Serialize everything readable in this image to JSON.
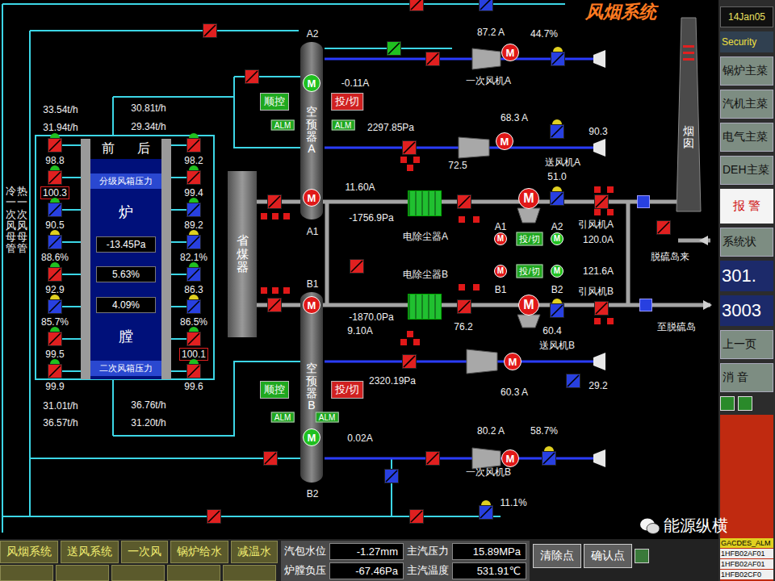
{
  "title": "风烟系统",
  "mains": [
    "冷一次风母管",
    "热一次风母管"
  ],
  "furnace": {
    "front": "前",
    "back": "后",
    "upper_box": "分级风箱压力",
    "lower_box": "二次风箱压力",
    "top_char": "炉",
    "bottom_char": "膛",
    "pressure": "-13.45Pa",
    "readings": [
      "5.63%",
      "4.09%"
    ]
  },
  "furnace_dampers": {
    "left": [
      {
        "value": "98.8",
        "boxed": false,
        "color": "#e02020",
        "hat": "#20c020"
      },
      {
        "value": "100.3",
        "boxed": true,
        "color": "#e02020",
        "hat": "#20c020"
      },
      {
        "value": "90.5",
        "boxed": false,
        "color": "#2840e0",
        "hat": "#20c020"
      },
      {
        "value": "88.6%",
        "boxed": false,
        "color": "#2840e0",
        "hat": "#e0d020"
      },
      {
        "value": "92.9",
        "boxed": false,
        "color": "#e02020",
        "hat": "#20c020"
      },
      {
        "value": "85.7%",
        "boxed": false,
        "color": "#2840e0",
        "hat": "#e0d020"
      },
      {
        "value": "99.5",
        "boxed": false,
        "color": "#e02020",
        "hat": "#20c020"
      },
      {
        "value": "99.9",
        "boxed": false,
        "color": "#e02020",
        "hat": "#20c020"
      }
    ],
    "right": [
      {
        "value": "98.2",
        "boxed": false,
        "color": "#e02020",
        "hat": "#20c020"
      },
      {
        "value": "99.4",
        "boxed": false,
        "color": "#e02020",
        "hat": "#20c020"
      },
      {
        "value": "89.2",
        "boxed": false,
        "color": "#2840e0",
        "hat": "#20c020"
      },
      {
        "value": "82.1%",
        "boxed": false,
        "color": "#2840e0",
        "hat": "#e0d020"
      },
      {
        "value": "86.3",
        "boxed": false,
        "color": "#2840e0",
        "hat": "#20c020"
      },
      {
        "value": "86.5%",
        "boxed": false,
        "color": "#2840e0",
        "hat": "#e0d020"
      },
      {
        "value": "100.1",
        "boxed": true,
        "color": "#e02020",
        "hat": "#20c020"
      },
      {
        "value": "99.6",
        "boxed": false,
        "color": "#e02020",
        "hat": "#20c020"
      }
    ]
  },
  "economizer": "省煤器",
  "air_heaters": [
    {
      "name": "空预器A",
      "sequence": "顺控",
      "switch": "投/切",
      "alarms": [
        "ALM",
        "ALM"
      ]
    },
    {
      "name": "空预器B",
      "sequence": "顺控",
      "switch": "投/切",
      "alarms": [
        "ALM",
        "ALM"
      ]
    }
  ],
  "precipitators": [
    {
      "color": "#20c030"
    },
    {
      "color": "#20c030"
    }
  ],
  "chimney": "烟囱",
  "labels": [
    "33.54t/h",
    "31.94t/h",
    "30.81t/h",
    "29.34t/h",
    "31.01t/h",
    "36.57t/h",
    "36.76t/h",
    "31.20t/h",
    "A2",
    "A1",
    "B1",
    "B2",
    "-0.11A",
    "2297.85Pa",
    "11.60A",
    "-1756.9Pa",
    "-1870.0Pa",
    "9.10A",
    "2320.19Pa",
    "0.02A",
    "87.2 A",
    "44.7%",
    "一次风机A",
    "68.3 A",
    "72.5",
    "90.3",
    "送风机A",
    "51.0",
    "120.0A",
    "引风机A",
    "121.6A",
    "引风机B",
    "A1",
    "A2",
    "B1",
    "B2",
    "76.2",
    "60.4",
    "送风机B",
    "60.3 A",
    "29.2",
    "80.2 A",
    "58.7%",
    "一次风机B",
    "11.1%",
    "脱硫岛来",
    "至脱硫岛",
    "电除尘器A",
    "电除尘器B"
  ],
  "motors": [
    {
      "label": "M",
      "color": "#20c020"
    },
    {
      "label": "M",
      "color": "#e01818"
    },
    {
      "label": "M",
      "color": "#e01818"
    },
    {
      "label": "M",
      "color": "#20c020"
    },
    {
      "label": "M",
      "color": "#e01818"
    },
    {
      "label": "M",
      "color": "#e01818"
    },
    {
      "label": "M",
      "color": "#e01818"
    },
    {
      "label": "M",
      "color": "#e01818"
    },
    {
      "label": "M",
      "color": "#e01818"
    },
    {
      "label": "M",
      "color": "#e01818"
    },
    {
      "label": "M",
      "color": "#e01818"
    },
    {
      "label": "M",
      "color": "#20c020"
    },
    {
      "label": "M",
      "color": "#e01818"
    },
    {
      "label": "M",
      "color": "#20c020"
    }
  ],
  "switches": [
    {
      "label": "投/切",
      "color": "#1fa81f"
    },
    {
      "label": "投/切",
      "color": "#1fa81f"
    }
  ],
  "dampers": [
    {
      "kind": "plain",
      "color": "#e02020"
    },
    {
      "kind": "plain",
      "color": "#e02020"
    },
    {
      "kind": "plain",
      "color": "#2840e0"
    },
    {
      "kind": "plain",
      "color": "#20c020"
    },
    {
      "kind": "plain",
      "color": "#e02020"
    },
    {
      "kind": "actuated",
      "color": "#2840e0",
      "hat": "#e0d020"
    },
    {
      "kind": "plain",
      "color": "#e02020"
    },
    {
      "kind": "plain",
      "color": "#e02020"
    },
    {
      "kind": "actuated",
      "color": "#2840e0",
      "hat": "#e0d020"
    },
    {
      "kind": "plain",
      "color": "#e02020"
    },
    {
      "kind": "plain",
      "color": "#e02020"
    },
    {
      "kind": "actuated",
      "color": "#2840e0",
      "hat": "#e0d020"
    },
    {
      "kind": "plain",
      "color": "#e02020"
    },
    {
      "kind": "gate",
      "color": "#2840e0"
    },
    {
      "kind": "plain",
      "color": "#e02020"
    },
    {
      "kind": "plain",
      "color": "#e02020"
    },
    {
      "kind": "plain",
      "color": "#e02020"
    },
    {
      "kind": "plain",
      "color": "#e02020"
    },
    {
      "kind": "actuated",
      "color": "#2840e0",
      "hat": "#e0d020"
    },
    {
      "kind": "plain",
      "color": "#e02020"
    },
    {
      "kind": "gate",
      "color": "#2840e0"
    },
    {
      "kind": "plain",
      "color": "#e02020"
    },
    {
      "kind": "plain",
      "color": "#2840e0"
    },
    {
      "kind": "actuated",
      "color": "#2840e0",
      "hat": "#e0d020"
    },
    {
      "kind": "plain",
      "color": "#e02020"
    },
    {
      "kind": "plain",
      "color": "#e02020"
    },
    {
      "kind": "plain",
      "color": "#2840e0"
    },
    {
      "kind": "plain",
      "color": "#e02020"
    },
    {
      "kind": "actuated",
      "color": "#2840e0",
      "hat": "#e0d020"
    },
    {
      "kind": "plain",
      "color": "#e02020"
    }
  ],
  "indicators": [
    {
      "color": "#e01818"
    },
    {
      "color": "#e01818"
    },
    {
      "color": "#e01818"
    },
    {
      "color": "#e01818"
    },
    {
      "color": "#e01818"
    },
    {
      "color": "#e01818"
    },
    {
      "color": "#e01818"
    },
    {
      "color": "#e01818"
    },
    {
      "color": "#e01818"
    },
    {
      "color": "#e01818"
    },
    {
      "color": "#e01818"
    },
    {
      "color": "#e01818"
    },
    {
      "color": "#e01818"
    },
    {
      "color": "#e01818"
    },
    {
      "color": "#e01818"
    },
    {
      "color": "#e01818"
    },
    {
      "color": "#e01818"
    },
    {
      "color": "#e01818"
    },
    {
      "color": "#e01818"
    },
    {
      "color": "#e01818"
    },
    {
      "color": "#e01818"
    },
    {
      "color": "#e01818"
    }
  ],
  "sidebar": {
    "date": "14Jan05",
    "security": "Security",
    "menu": [
      "锅炉主菜",
      "汽机主菜",
      "电气主菜",
      "DEH主菜"
    ],
    "alarm": "报 警",
    "status": "系统状",
    "counters": [
      "301.",
      "3003"
    ],
    "prev": "上一页",
    "mute": "消 音",
    "alarm_list": {
      "title": "GACDES_ALM",
      "rows": [
        "1HFB02AF01",
        "1HFB02AF01",
        "1HFB02CF0"
      ]
    }
  },
  "bottom": {
    "nav": [
      "风烟系统",
      "送风系统",
      "一次风",
      "锅炉给水",
      "减温水"
    ],
    "status": [
      {
        "label": "汽包水位",
        "value": "-1.27mm"
      },
      {
        "label": "主汽压力",
        "value": "15.89MPa"
      },
      {
        "label": "炉膛负压",
        "value": "-67.46Pa"
      },
      {
        "label": "主汽温度",
        "value": "531.91℃"
      }
    ],
    "actions": [
      "清除点",
      "确认点"
    ]
  },
  "watermark": "能源纵横"
}
